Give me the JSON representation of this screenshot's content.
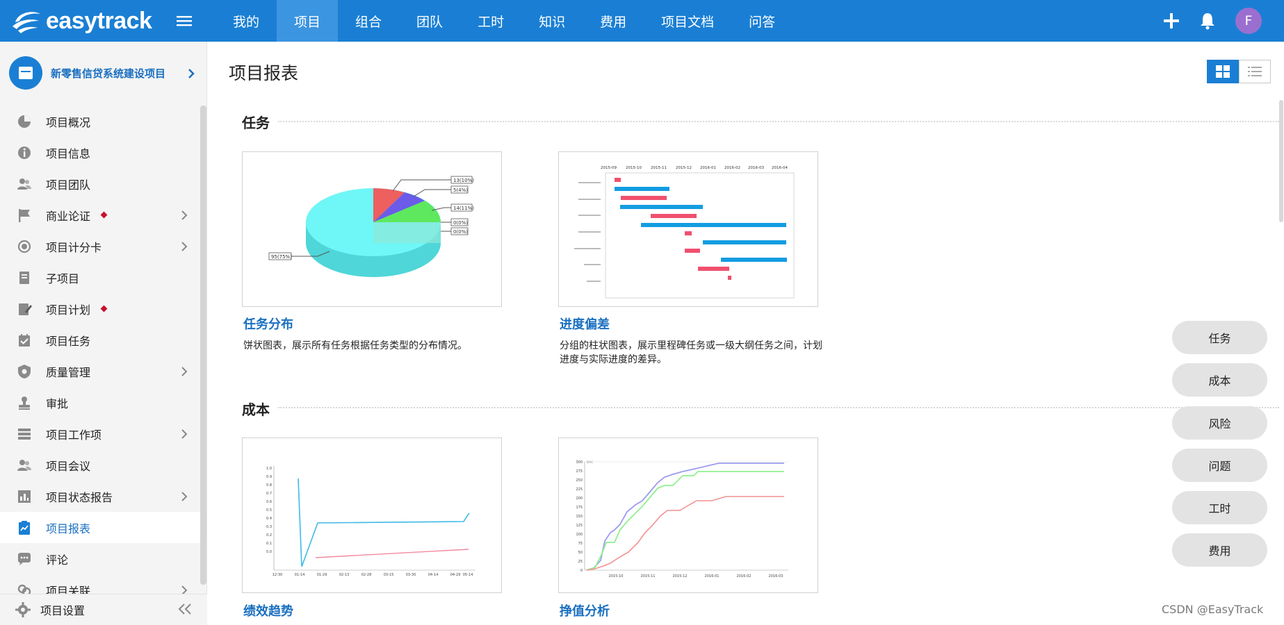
{
  "brand": {
    "name": "easytrack"
  },
  "nav": {
    "items": [
      {
        "label": "我的",
        "active": false
      },
      {
        "label": "项目",
        "active": true
      },
      {
        "label": "组合",
        "active": false
      },
      {
        "label": "团队",
        "active": false
      },
      {
        "label": "工时",
        "active": false
      },
      {
        "label": "知识",
        "active": false
      },
      {
        "label": "费用",
        "active": false
      },
      {
        "label": "项目文档",
        "active": false
      },
      {
        "label": "问答",
        "active": false
      }
    ]
  },
  "user": {
    "initial": "F"
  },
  "sidebar": {
    "project_name": "新零售信贷系统建设项目",
    "items": [
      {
        "label": "项目概况",
        "icon": "pie-chart-icon",
        "chevron": false,
        "badge": false
      },
      {
        "label": "项目信息",
        "icon": "info-icon",
        "chevron": false,
        "badge": false
      },
      {
        "label": "项目团队",
        "icon": "team-icon",
        "chevron": false,
        "badge": false
      },
      {
        "label": "商业论证",
        "icon": "flag-icon",
        "chevron": true,
        "badge": true
      },
      {
        "label": "项目计分卡",
        "icon": "target-icon",
        "chevron": true,
        "badge": false
      },
      {
        "label": "子项目",
        "icon": "subproject-icon",
        "chevron": false,
        "badge": false
      },
      {
        "label": "项目计划",
        "icon": "plan-edit-icon",
        "chevron": false,
        "badge": true
      },
      {
        "label": "项目任务",
        "icon": "task-check-icon",
        "chevron": false,
        "badge": false
      },
      {
        "label": "质量管理",
        "icon": "shield-icon",
        "chevron": true,
        "badge": false
      },
      {
        "label": "审批",
        "icon": "stamp-icon",
        "chevron": false,
        "badge": false
      },
      {
        "label": "项目工作项",
        "icon": "list-icon",
        "chevron": true,
        "badge": false
      },
      {
        "label": "项目会议",
        "icon": "meeting-icon",
        "chevron": false,
        "badge": false
      },
      {
        "label": "项目状态报告",
        "icon": "bar-report-icon",
        "chevron": true,
        "badge": false
      },
      {
        "label": "项目报表",
        "icon": "report-chart-icon",
        "chevron": false,
        "badge": false,
        "active": true
      },
      {
        "label": "评论",
        "icon": "comment-icon",
        "chevron": false,
        "badge": false
      },
      {
        "label": "项目关联",
        "icon": "link-icon",
        "chevron": true,
        "badge": false
      }
    ],
    "footer_label": "项目设置"
  },
  "main": {
    "title": "项目报表",
    "sections": [
      {
        "title": "任务",
        "cards": [
          {
            "title": "任务分布",
            "desc": "饼状图表，展示所有任务根据任务类型的分布情况。"
          },
          {
            "title": "进度偏差",
            "desc": "分组的柱状图表，展示里程碑任务或一级大纲任务之间，计划进度与实际进度的差异。"
          }
        ]
      },
      {
        "title": "成本",
        "cards": [
          {
            "title": "绩效趋势",
            "desc": ""
          },
          {
            "title": "挣值分析",
            "desc": ""
          }
        ]
      }
    ],
    "pie_labels": [
      "13(10%)",
      "5(4%)",
      "14(11%)",
      "0(0%)",
      "0(0%)",
      "95(75%)"
    ],
    "gantt_months": [
      "2015-09",
      "2015-10",
      "2015-11",
      "2015-12",
      "2016-01",
      "2016-02",
      "2016-03",
      "2016-04"
    ],
    "trend_yticks": [
      "1.0",
      "0.9",
      "0.8",
      "0.7",
      "0.6",
      "0.5",
      "0.4",
      "0.3",
      "0.2",
      "0.1",
      "0.0"
    ],
    "trend_xticks": [
      "12-30",
      "01-14",
      "01-29",
      "02-13",
      "02-28",
      "03-15",
      "03-30",
      "04-14",
      "04-29",
      "05-14"
    ],
    "ev_yticks": [
      "300",
      "275",
      "250",
      "225",
      "200",
      "175",
      "150",
      "125",
      "100",
      "75",
      "50",
      "25",
      "0"
    ],
    "ev_xticks": [
      "2015-10",
      "2015-11",
      "2015-12",
      "2016-01",
      "2016-02",
      "2016-03"
    ],
    "ev_bac": "BAC"
  },
  "filters": [
    "任务",
    "成本",
    "风险",
    "问题",
    "工时",
    "费用"
  ],
  "watermark": "CSDN @EasyTrack",
  "colors": {
    "brand": "#1a7fd4",
    "link": "#1a6fc0",
    "badge": "#c8102e"
  }
}
